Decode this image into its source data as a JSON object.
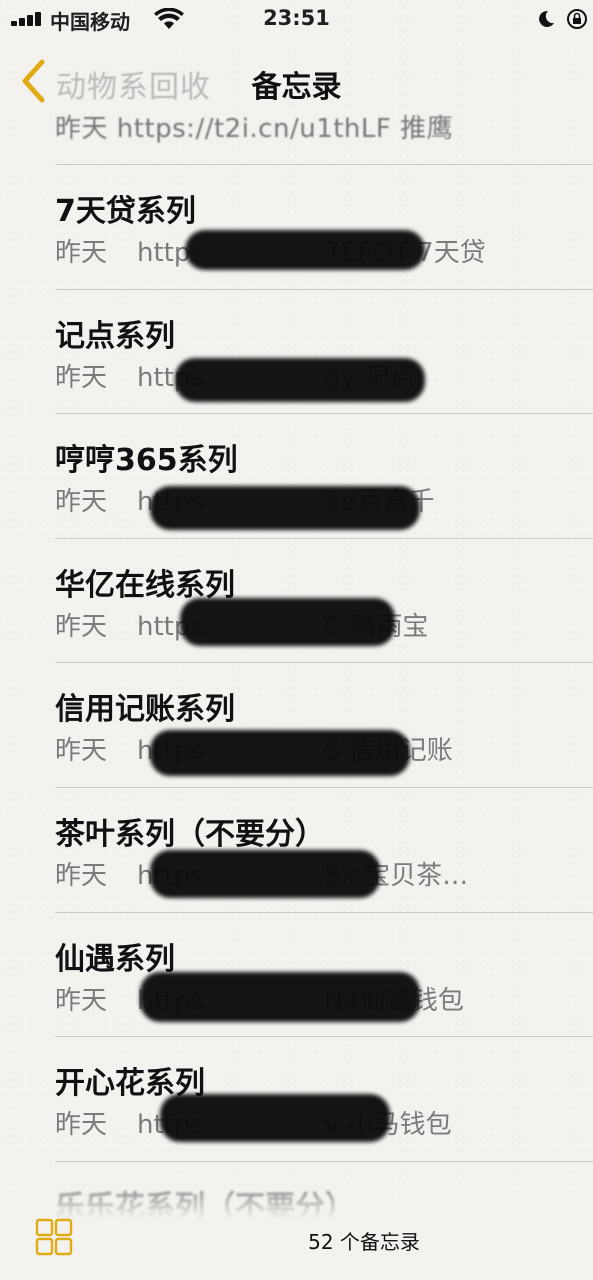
{
  "status_bar": {
    "carrier": "中国移动",
    "time": "23:51"
  },
  "nav": {
    "back_ghost_title": "动物系回收",
    "title": "备忘录"
  },
  "partial_top_note": {
    "subtitle": "昨天   https://t2i.cn/u1thLF 推鹰"
  },
  "notes": [
    {
      "title": "7天贷系列",
      "date": "昨天",
      "url": "https",
      "suffix": "7EPOT 7天贷"
    },
    {
      "title": "记点系列",
      "date": "昨天",
      "url": "https",
      "suffix": "gy 记点"
    },
    {
      "title": "哼哼365系列",
      "date": "昨天",
      "url": "https",
      "suffix": "5e百富千"
    },
    {
      "title": "华亿在线系列",
      "date": "昨天",
      "url": "https",
      "suffix": "C 财雨宝"
    },
    {
      "title": "信用记账系列",
      "date": "昨天",
      "url": "https",
      "suffix": "S 信用记账"
    },
    {
      "title": "茶叶系列（不要分）",
      "date": "昨天",
      "url": "https",
      "suffix": "5x 宝贝茶…"
    },
    {
      "title": "仙遇系列",
      "date": "昨天",
      "url": "https",
      "suffix": "N4仙遇钱包"
    },
    {
      "title": "开心花系列",
      "date": "昨天",
      "url": "https",
      "suffix": "v 小马钱包"
    }
  ],
  "partial_bottom_note": {
    "title": "乐乐花系列（不要分）"
  },
  "toolbar": {
    "count": "52 个备忘录"
  }
}
